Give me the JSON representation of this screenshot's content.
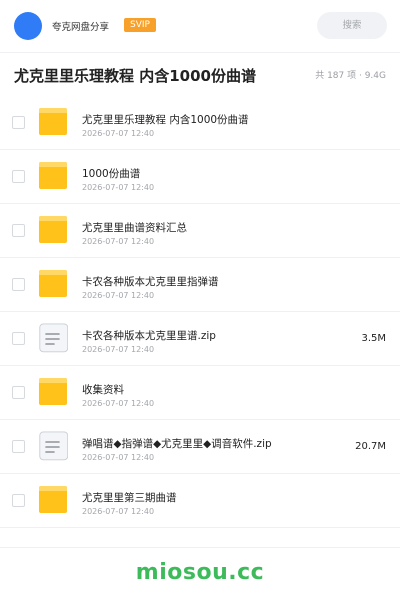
{
  "header": {
    "brand": "夸克网盘分享",
    "badge": "SVIP",
    "search_placeholder": "搜索",
    "avatar_color": "#2f7cf6"
  },
  "page": {
    "title": "尤克里里乐理教程 内含1000份曲谱",
    "summary": "共 187 项 · 9.4G"
  },
  "files": [
    {
      "name": "尤克里里乐理教程 内含1000份曲谱",
      "date": "2026-07-07 12:40",
      "size": "",
      "type": "folder"
    },
    {
      "name": "1000份曲谱",
      "date": "2026-07-07 12:40",
      "size": "",
      "type": "folder"
    },
    {
      "name": "尤克里里曲谱资料汇总",
      "date": "2026-07-07 12:40",
      "size": "",
      "type": "folder"
    },
    {
      "name": "卡农各种版本尤克里里指弹谱",
      "date": "2026-07-07 12:40",
      "size": "",
      "type": "folder"
    },
    {
      "name": "卡农各种版本尤克里里谱.zip",
      "date": "2026-07-07 12:40",
      "size": "3.5M",
      "type": "file"
    },
    {
      "name": "收集资料",
      "date": "2026-07-07 12:40",
      "size": "",
      "type": "folder"
    },
    {
      "name": "弹唱谱◆指弹谱◆尤克里里◆调音软件.zip",
      "date": "2026-07-07 12:40",
      "size": "20.7M",
      "type": "file"
    },
    {
      "name": "尤克里里第三期曲谱",
      "date": "2026-07-07 12:40",
      "size": "",
      "type": "folder"
    }
  ],
  "footer": {
    "watermark": "miosou.cc",
    "watermark_color": "#3dbb5a"
  },
  "colors": {
    "folder": "#ffc21a",
    "folder_tab": "#ffd866",
    "badge": "#f7a02a"
  }
}
